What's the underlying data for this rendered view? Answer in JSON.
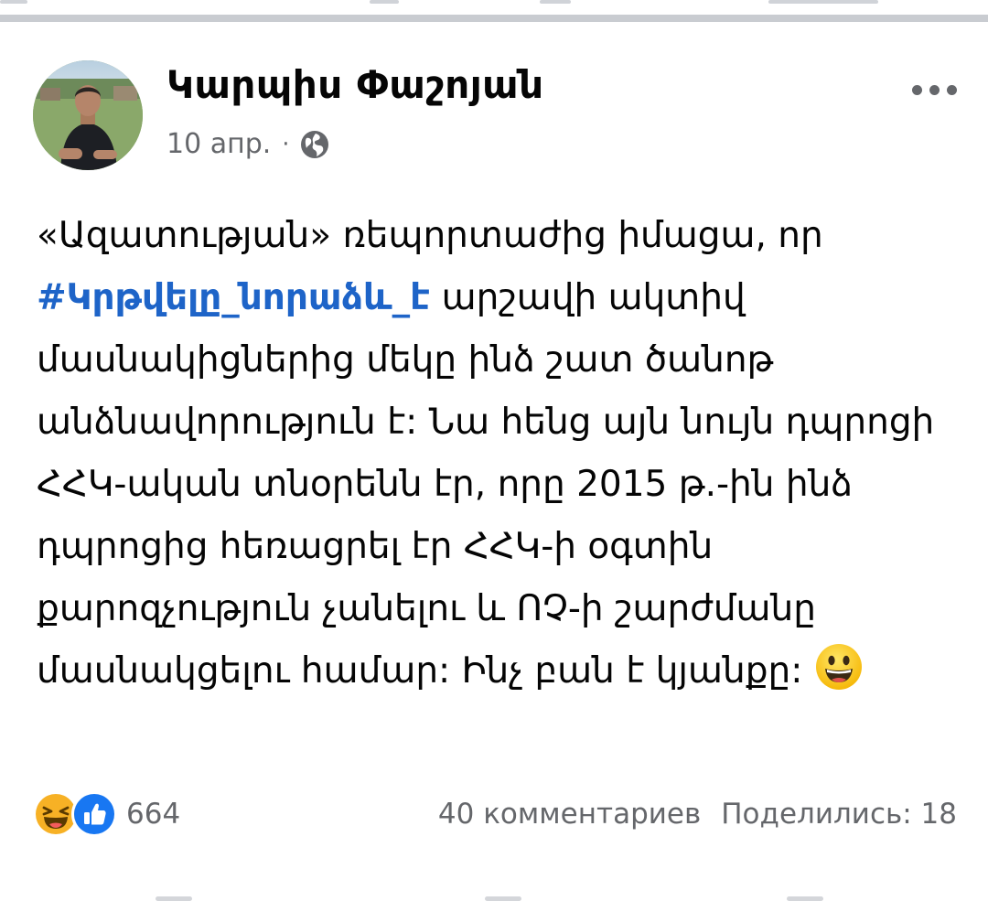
{
  "post": {
    "author": "Կարպիս Փաշոյան",
    "date": "10 апр.",
    "separator": "·",
    "privacy_icon": "globe-icon",
    "more_icon": "more-horizontal-icon",
    "body": {
      "text_before": "«Ազատության» ռեպորտաժից իմացա, որ ",
      "hashtag": "#Կրթվելը_նորաձև_է",
      "text_after": " արշավի ակտիվ մասնակիցներից մեկը ինձ շատ ծանոթ անձնավորություն է: Նա հենց այն նույն դպրոցի ՀՀԿ-ական տնօրենն էր, որը 2015 թ.-ին ինձ դպրոցից հեռացրել էր ՀՀԿ-ի օգտին քարոզչություն չանելու և ՈՉ-ի շարժմանը մասնակցելու համար: Ինչ բան է կյանքը: ",
      "emoji": "grinning-face-emoji"
    },
    "reactions": {
      "icons": [
        "haha-reaction-icon",
        "like-reaction-icon"
      ],
      "count": "664"
    },
    "comments_label": "40 комментариев",
    "shares_label": "Поделились: 18"
  },
  "colors": {
    "hashtag": "#1e64c8",
    "secondary_text": "#65676b",
    "like_blue": "#1877f2",
    "haha_yellow": "#f7b125",
    "divider": "#c9ccd1"
  }
}
